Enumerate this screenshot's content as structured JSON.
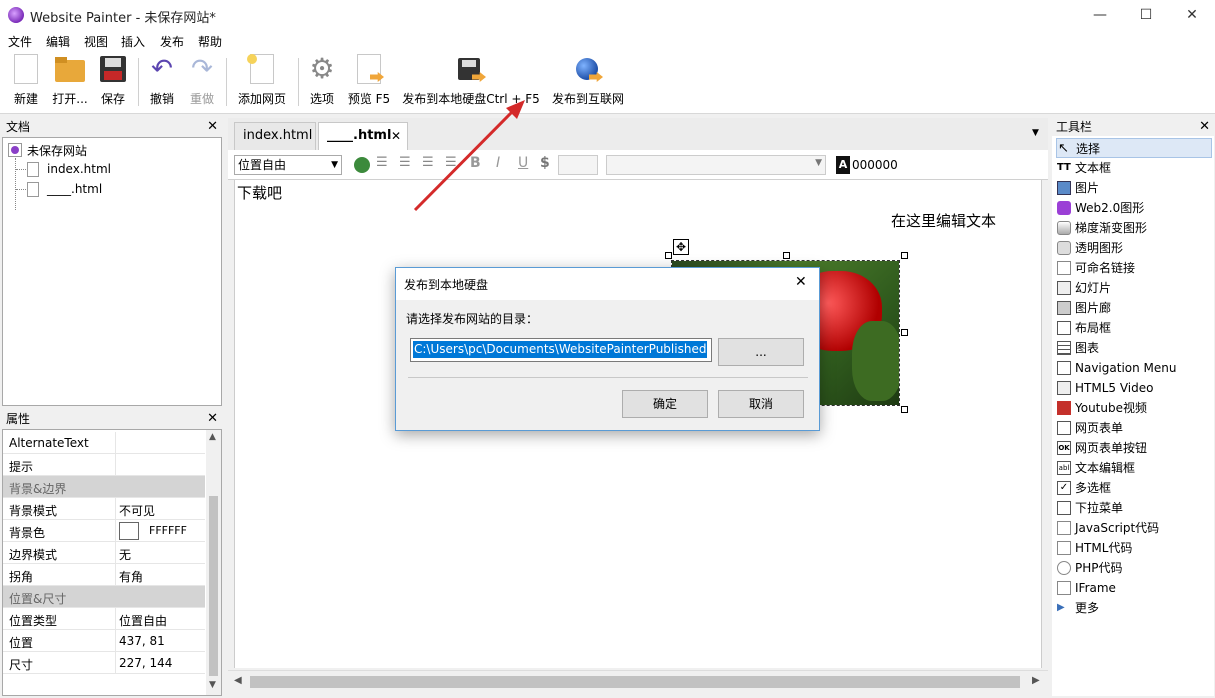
{
  "window": {
    "title": "Website Painter - 未保存网站*",
    "minimize": "—",
    "maximize": "☐",
    "close": "✕"
  },
  "menu": [
    "文件",
    "编辑",
    "视图",
    "插入",
    "发布",
    "帮助"
  ],
  "toolbar": {
    "new": "新建",
    "open": "打开...",
    "save": "保存",
    "undo": "撤销",
    "redo": "重做",
    "add_page": "添加网页",
    "options": "选项",
    "preview": "预览 F5",
    "publish_local": "发布到本地硬盘Ctrl + F5",
    "publish_web": "发布到互联网"
  },
  "docs_panel": {
    "title": "文档",
    "close": "✕",
    "root": "未保存网站",
    "files": [
      "index.html",
      "____.html"
    ]
  },
  "props_panel": {
    "title": "属性",
    "close": "✕",
    "rows": [
      {
        "k": "AlternateText",
        "v": ""
      },
      {
        "k": "提示",
        "v": ""
      },
      {
        "k": "背景&边界",
        "v": "",
        "cat": true
      },
      {
        "k": "背景模式",
        "v": "不可见"
      },
      {
        "k": "背景色",
        "v": "FFFFFF"
      },
      {
        "k": "边界模式",
        "v": "无"
      },
      {
        "k": "拐角",
        "v": "有角"
      },
      {
        "k": "位置&尺寸",
        "v": "",
        "cat": true
      },
      {
        "k": "位置类型",
        "v": "位置自由"
      },
      {
        "k": "位置",
        "v": "437, 81"
      },
      {
        "k": "尺寸",
        "v": "227, 144"
      }
    ]
  },
  "editor": {
    "tabs": [
      "index.html",
      "____.html"
    ],
    "tab_close": "✕",
    "position_select": "位置自由",
    "color_value": "000000",
    "color_label": "A",
    "canvas_text_1": "下载吧",
    "canvas_text_2": "在这里编辑文本"
  },
  "toolbox": {
    "title": "工具栏",
    "close": "✕",
    "items": [
      "选择",
      "文本框",
      "图片",
      "Web2.0图形",
      "梯度渐变图形",
      "透明图形",
      "可命名链接",
      "幻灯片",
      "图片廊",
      "布局框",
      "图表",
      "Navigation Menu",
      "HTML5 Video",
      "Youtube视频",
      "网页表单",
      "网页表单按钮",
      "文本编辑框",
      "多选框",
      "下拉菜单",
      "JavaScript代码",
      "HTML代码",
      "PHP代码",
      "IFrame",
      "更多"
    ]
  },
  "dialog": {
    "title": "发布到本地硬盘",
    "prompt": "请选择发布网站的目录：",
    "path": "C:\\Users\\pc\\Documents\\WebsitePainterPublished",
    "browse": "...",
    "ok": "确定",
    "cancel": "取消",
    "close": "✕"
  },
  "colors": {
    "accent": "#1e66c8",
    "annotation_arrow": "#d42a2a",
    "selection": "#0078d7"
  }
}
